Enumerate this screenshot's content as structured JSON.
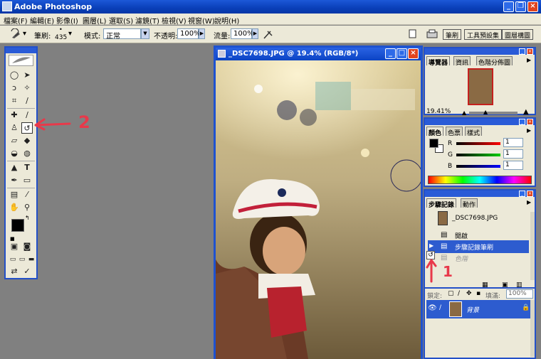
{
  "app": {
    "title": "Adobe Photoshop"
  },
  "menu": [
    "檔案(F)",
    "編輯(E)",
    "影像(I)",
    "圖層(L)",
    "選取(S)",
    "濾鏡(T)",
    "檢視(V)",
    "視窗(W)",
    "說明(H)"
  ],
  "options": {
    "brush_label": "筆刷:",
    "brush_size": "435",
    "mode_label": "模式:",
    "mode_value": "正常",
    "opacity_label": "不透明:",
    "opacity_value": "100%",
    "flow_label": "流量:",
    "flow_value": "100%",
    "tab_buttons": [
      "筆刷",
      "工具預設集",
      "圖層構圖"
    ]
  },
  "document": {
    "title": "_DSC7698.JPG @ 19.4% (RGB/8*)"
  },
  "navigator": {
    "tabs": [
      "導覽器",
      "資訊",
      "色階分佈圖"
    ],
    "zoom": "19.41%"
  },
  "color": {
    "tabs": [
      "顏色",
      "色票",
      "樣式"
    ],
    "channels": [
      {
        "label": "R",
        "value": "1",
        "color": "#cc1111"
      },
      {
        "label": "G",
        "value": "1",
        "color": "#11aa11"
      },
      {
        "label": "B",
        "value": "1",
        "color": "#1111cc"
      }
    ]
  },
  "history": {
    "tabs": [
      "步驟記錄",
      "動作"
    ],
    "snapshot": "_DSC7698.JPG",
    "items": [
      {
        "label": "開啟",
        "state": "normal"
      },
      {
        "label": "步驟記錄筆刷",
        "state": "selected"
      },
      {
        "label": "色階",
        "state": "dimmed"
      }
    ]
  },
  "layers": {
    "lock_label": "鎖定:",
    "fill_label": "填滿:",
    "fill_value": "100%",
    "layer_name": "背景"
  },
  "annotations": {
    "tool_marker": "2",
    "history_marker": "1",
    "color": "#e8394a"
  }
}
